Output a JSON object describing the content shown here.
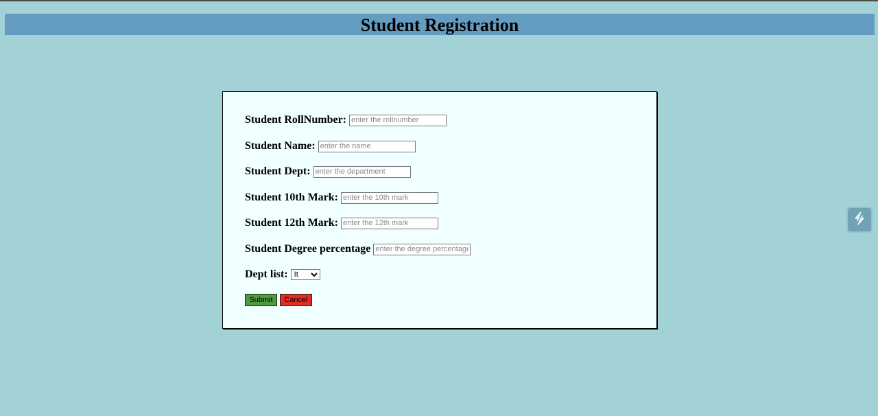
{
  "page": {
    "title": "Student Registration"
  },
  "form": {
    "fields": [
      {
        "label": "Student RollNumber:",
        "placeholder": "enter the rollnumber",
        "value": ""
      },
      {
        "label": "Student Name:",
        "placeholder": "enter the name",
        "value": ""
      },
      {
        "label": "Student Dept:",
        "placeholder": "enter the department",
        "value": ""
      },
      {
        "label": "Student 10th Mark:",
        "placeholder": "enter the 10th mark",
        "value": ""
      },
      {
        "label": "Student 12th Mark:",
        "placeholder": "enter the 12th mark",
        "value": ""
      },
      {
        "label": "Student Degree percentage",
        "placeholder": "enter the degree percentage",
        "value": ""
      }
    ],
    "dept_list": {
      "label": "Dept list:",
      "selected": "It"
    },
    "submit_label": "Submit",
    "cancel_label": "Cancel"
  },
  "colors": {
    "page_background": "#a2d2d6",
    "header_background": "#659dc2",
    "form_background": "#f0ffff",
    "submit": "#4f9a3c",
    "cancel": "#e02e24"
  },
  "widgets": {
    "side_widget_icon": "extension-icon"
  }
}
